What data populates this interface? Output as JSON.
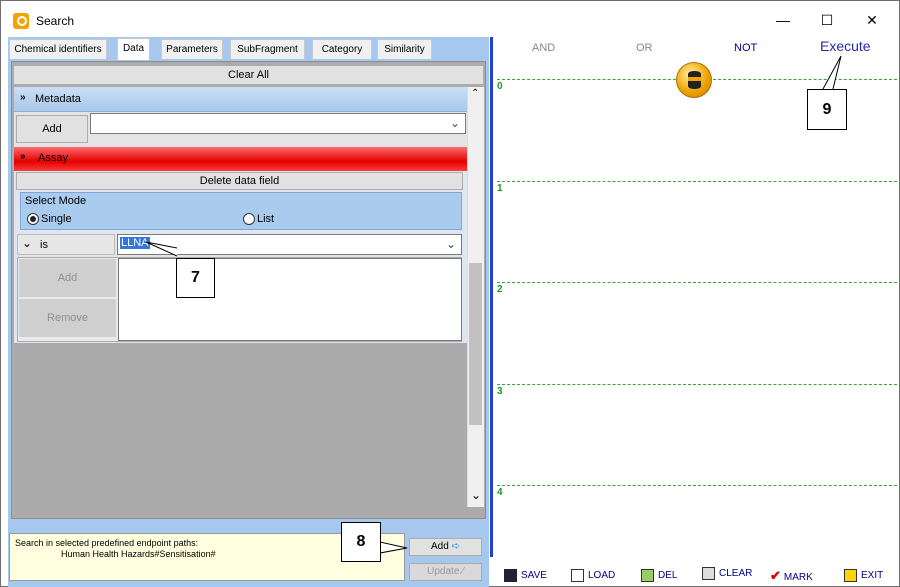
{
  "window": {
    "title": "Search",
    "min": "—",
    "max": "☐",
    "close": "✕"
  },
  "tabs": [
    {
      "label": "Chemical identifiers"
    },
    {
      "label": "Data"
    },
    {
      "label": "Parameters"
    },
    {
      "label": "SubFragment"
    },
    {
      "label": "Category"
    },
    {
      "label": "Similarity"
    }
  ],
  "clear_all": "Clear All",
  "metadata": {
    "header": "Metadata",
    "add": "Add",
    "value": ""
  },
  "assay": {
    "header": "Assay",
    "delete": "Delete data field"
  },
  "select_mode": {
    "legend": "Select Mode",
    "single": "Single",
    "list": "List",
    "selected": "single"
  },
  "condition": {
    "operator": "is",
    "value": "LLNA"
  },
  "list_buttons": {
    "add": "Add",
    "remove": "Remove"
  },
  "status": {
    "line1": "Search in selected predefined endpoint paths:",
    "line2": "Human Health Hazards#Sensitisation#"
  },
  "actions": {
    "add": "Add",
    "update": "Update"
  },
  "logic": {
    "and": "AND",
    "or": "OR",
    "not": "NOT",
    "execute": "Execute"
  },
  "levels": [
    "0",
    "1",
    "2",
    "3",
    "4"
  ],
  "callouts": {
    "c7": "7",
    "c8": "8",
    "c9": "9"
  },
  "toolbar": {
    "save": "SAVE",
    "load": "LOAD",
    "del": "DEL",
    "clear": "CLEAR",
    "mark": "MARK",
    "exit": "EXIT"
  }
}
